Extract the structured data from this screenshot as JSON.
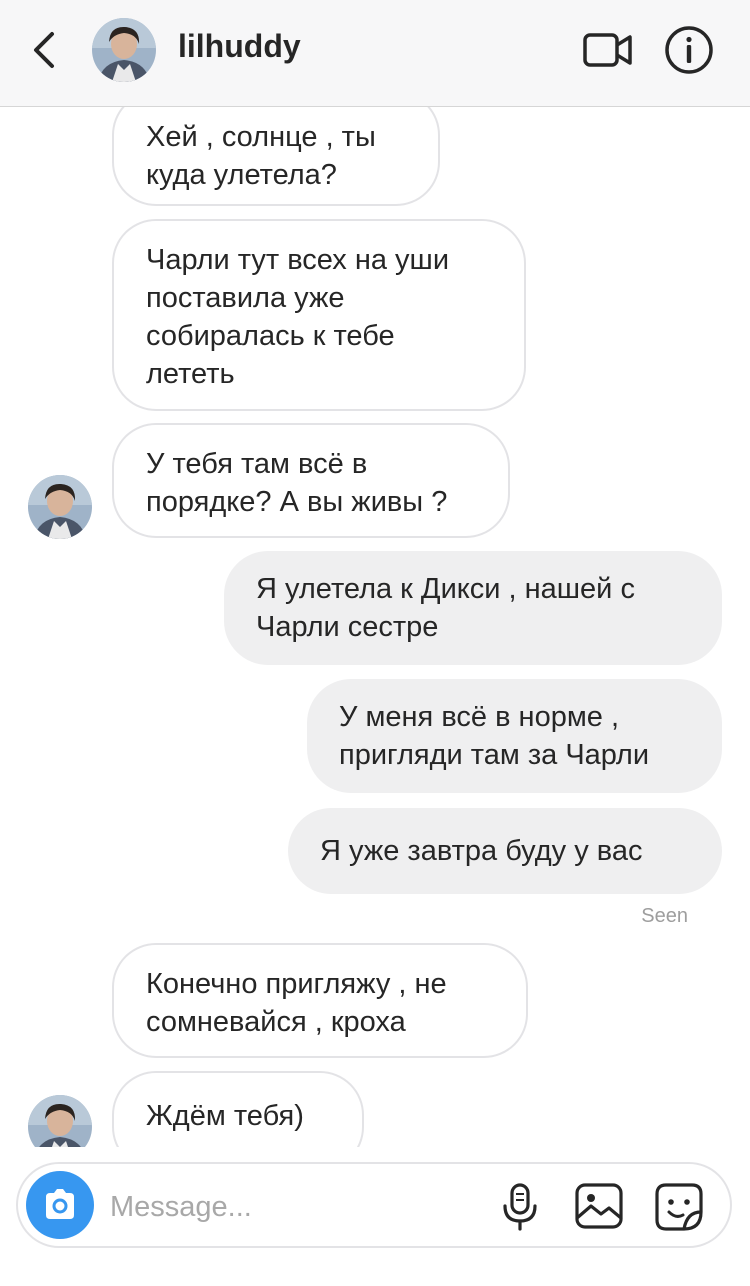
{
  "header": {
    "username": "lilhuddy"
  },
  "thread": {
    "messages": [
      {
        "side": "in",
        "lines": [
          "Хей , солнце , ты",
          "куда улетела?"
        ]
      },
      {
        "side": "in",
        "lines": [
          "Чарли тут всех на уши",
          "поставила уже",
          "собиралась к тебе",
          "лететь"
        ]
      },
      {
        "side": "in",
        "lines": [
          "У тебя там всё в",
          "порядке? А вы живы ?"
        ]
      },
      {
        "side": "out",
        "lines": [
          "Я улетела к Дикси , нашей с",
          "Чарли сестре"
        ]
      },
      {
        "side": "out",
        "lines": [
          "У меня всё в норме ,",
          "пригляди там за Чарли"
        ]
      },
      {
        "side": "out",
        "lines": [
          "Я уже завтра буду у вас"
        ]
      },
      {
        "side": "in",
        "lines": [
          "Конечно пригляжу , не",
          "сомневайся , кроха"
        ]
      },
      {
        "side": "in",
        "lines": [
          "Ждём тебя)"
        ]
      }
    ],
    "seen_label": "Seen"
  },
  "composer": {
    "placeholder": "Message..."
  },
  "colors": {
    "accent": "#3797f0",
    "outgoing_bubble": "#efeff0",
    "incoming_border": "#e3e3e6"
  },
  "icons": [
    "back-chevron-icon",
    "video-camera-icon",
    "info-icon",
    "camera-icon",
    "microphone-icon",
    "gallery-icon",
    "sticker-icon"
  ]
}
